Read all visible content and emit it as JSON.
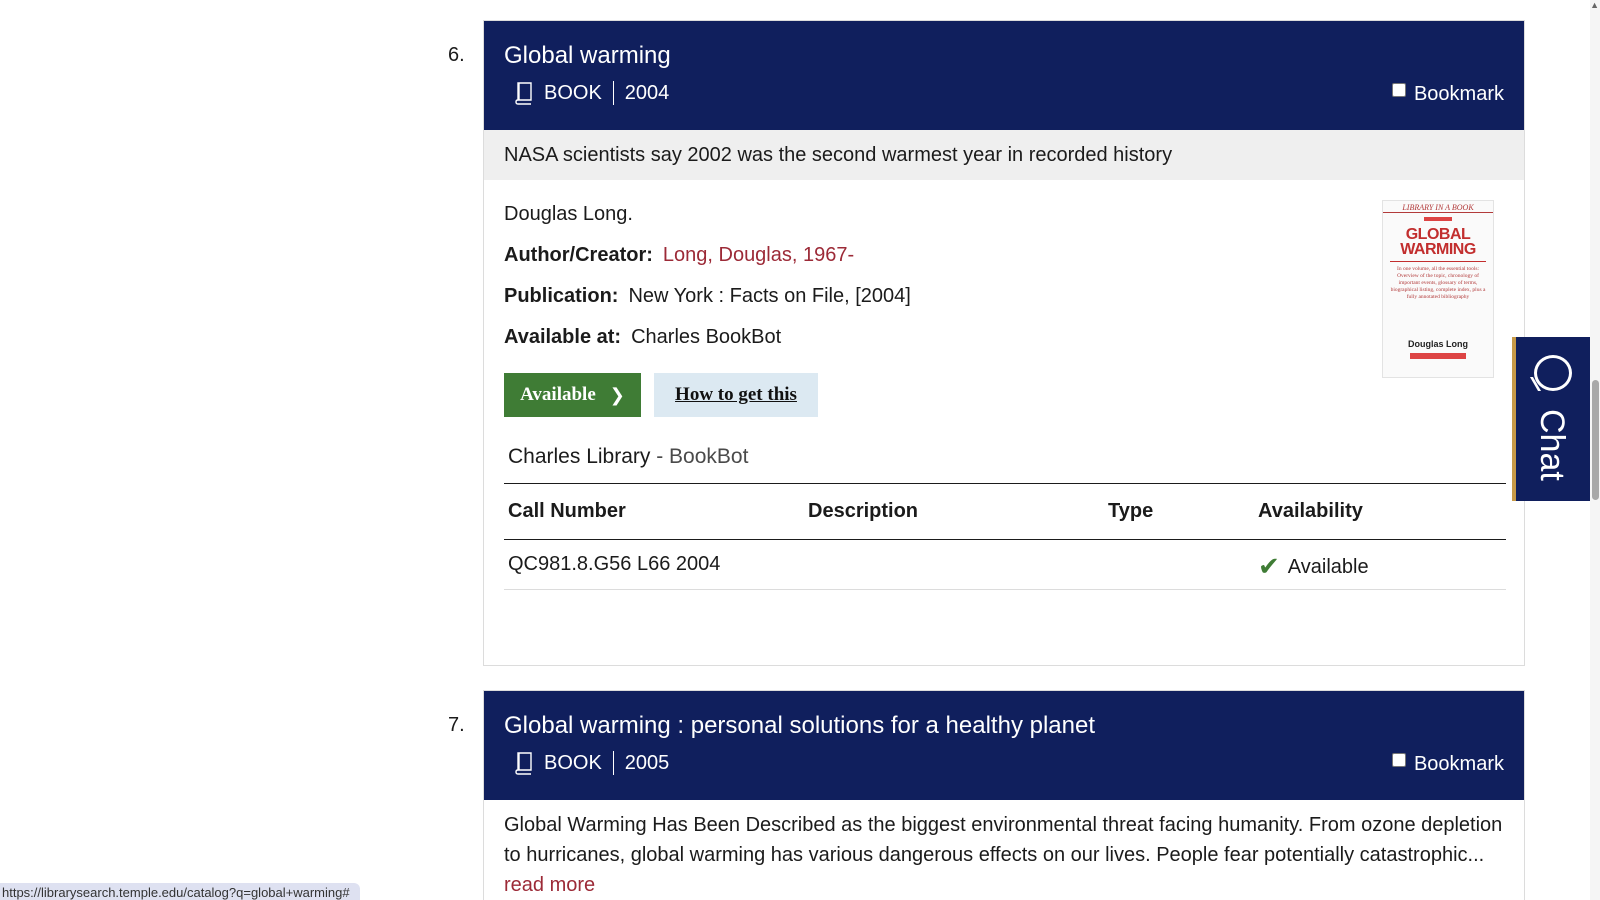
{
  "results": [
    {
      "number": "6.",
      "title": "Global warming",
      "format": "BOOK",
      "year": "2004",
      "bookmark_label": "Bookmark",
      "subtitle": "NASA scientists say 2002 was the second warmest year in recorded history",
      "responsibility": "Douglas Long.",
      "author_label": "Author/Creator:",
      "author_value": "Long, Douglas, 1967-",
      "publication_label": "Publication:",
      "publication_value": "New York : Facts on File, [2004]",
      "available_at_label": "Available at:",
      "available_at_value": "Charles BookBot",
      "available_button": "Available",
      "how_button": "How to get this",
      "library_name": "Charles Library",
      "library_location": " - BookBot",
      "holdings_headers": [
        "Call Number",
        "Description",
        "Type",
        "Availability"
      ],
      "holdings_rows": [
        {
          "call_number": "QC981.8.G56 L66 2004",
          "description": "",
          "type": "",
          "availability": "Available"
        }
      ],
      "cover": {
        "series": "LIBRARY IN A BOOK",
        "title_line1": "GLOBAL",
        "title_line2": "WARMING",
        "blurb": "In one volume, all the essential tools: Overview of the topic, chronology of important events, glossary of terms, biographical listing, complete index, plus a fully annotated bibliography",
        "author": "Douglas Long"
      }
    },
    {
      "number": "7.",
      "title": "Global warming : personal solutions for a healthy planet",
      "format": "BOOK",
      "year": "2005",
      "bookmark_label": "Bookmark",
      "summary": "Global Warming Has Been Described as the biggest environmental threat facing humanity. From ozone depletion to hurricanes, global warming has various dangerous effects on our lives. People fear potentially catastrophic...",
      "read_more": "read more"
    }
  ],
  "chat_label": "Chat",
  "status_url": "https://librarysearch.temple.edu/catalog?q=global+warming#",
  "colors": {
    "header_navy": "#101f5d",
    "available_green": "#3f7c35",
    "link_red": "#9c2a37",
    "how_bg": "#dce9f2",
    "subtitle_bg": "#efefef"
  }
}
